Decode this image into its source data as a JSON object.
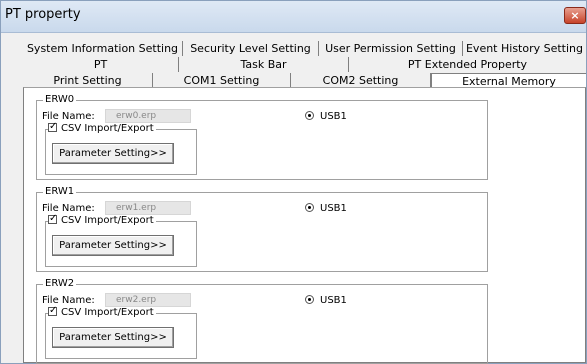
{
  "window": {
    "title": "PT property",
    "close_label": "×"
  },
  "tabs": {
    "row1": [
      "System Information Setting",
      "Security Level Setting",
      "User Permission Setting",
      "Event History Setting"
    ],
    "row2": [
      "PT",
      "Task Bar",
      "PT Extended Property"
    ],
    "row3": [
      "Print Setting",
      "COM1 Setting",
      "COM2 Setting",
      "External Memory"
    ],
    "active": "External Memory"
  },
  "groups": [
    {
      "label": "ERW0",
      "file_name_label": "File Name:",
      "file_name_value": "erw0.erp",
      "usb_label": "USB1",
      "csv_label": "CSV Import/Export",
      "button_label": "Parameter Setting>>"
    },
    {
      "label": "ERW1",
      "file_name_label": "File Name:",
      "file_name_value": "erw1.erp",
      "usb_label": "USB1",
      "csv_label": "CSV Import/Export",
      "button_label": "Parameter Setting>>"
    },
    {
      "label": "ERW2",
      "file_name_label": "File Name:",
      "file_name_value": "erw2.erp",
      "usb_label": "USB1",
      "csv_label": "CSV Import/Export",
      "button_label": "Parameter Setting>>"
    }
  ],
  "colors": {
    "close_button": "#c7432a",
    "titlebar": "#dfe9f5"
  }
}
